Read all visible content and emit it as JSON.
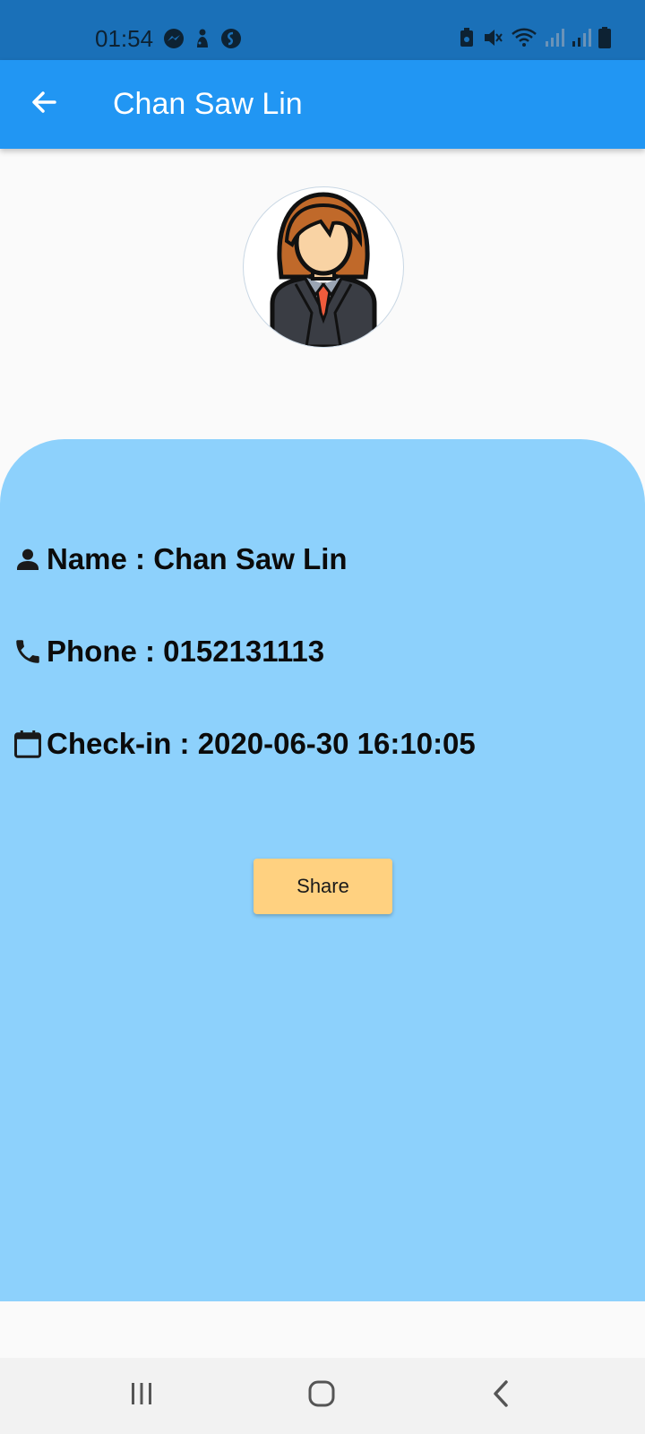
{
  "status_bar": {
    "time": "01:54",
    "left_icons": [
      "messenger-icon",
      "app-notification-icon",
      "shazam-icon"
    ],
    "right_icons": [
      "battery-saver-icon",
      "mute-icon",
      "wifi-icon",
      "signal-icon",
      "signal-icon",
      "battery-icon"
    ]
  },
  "app_bar": {
    "title": "Chan Saw Lin",
    "back_icon": "arrow-back-icon"
  },
  "profile": {
    "avatar_icon": "businessperson-avatar-icon"
  },
  "details": {
    "name": "Name : Chan Saw Lin",
    "phone": "Phone : 0152131113",
    "checkin": "Check-in : 2020-06-30 16:10:05"
  },
  "actions": {
    "share_label": "Share"
  },
  "nav": {
    "items": [
      "recent-apps-icon",
      "home-icon",
      "back-icon"
    ]
  },
  "colors": {
    "status_bar": "#1a70b8",
    "app_bar": "#2196f3",
    "card": "#8dd1fc",
    "share_button": "#ffd180"
  }
}
